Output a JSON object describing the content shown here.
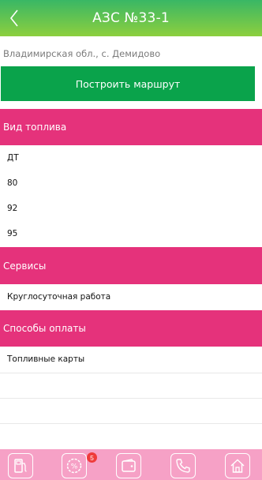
{
  "header": {
    "title": "АЗС №33-1"
  },
  "address": "Владимирская обл., с. Демидово",
  "route_button": "Построить маршрут",
  "fuel": {
    "title": "Вид топлива",
    "items": [
      "ДТ",
      "80",
      "92",
      "95"
    ]
  },
  "services": {
    "title": "Сервисы",
    "items": [
      "Круглосуточная работа"
    ]
  },
  "payment": {
    "title": "Способы оплаты",
    "items": [
      "Топливные карты"
    ]
  },
  "tabbar": {
    "promo_badge": "5",
    "tabs": [
      "fuel-pump-icon",
      "discount-percent-icon",
      "wallet-icon",
      "phone-icon",
      "home-icon"
    ]
  },
  "colors": {
    "header_gradient": [
      "#39b765",
      "#8dcf3e"
    ],
    "route_button": "#0aa34b",
    "section_header": "#e5327b",
    "tabbar": "#f6a1c6",
    "badge": "#ef3b3b"
  }
}
